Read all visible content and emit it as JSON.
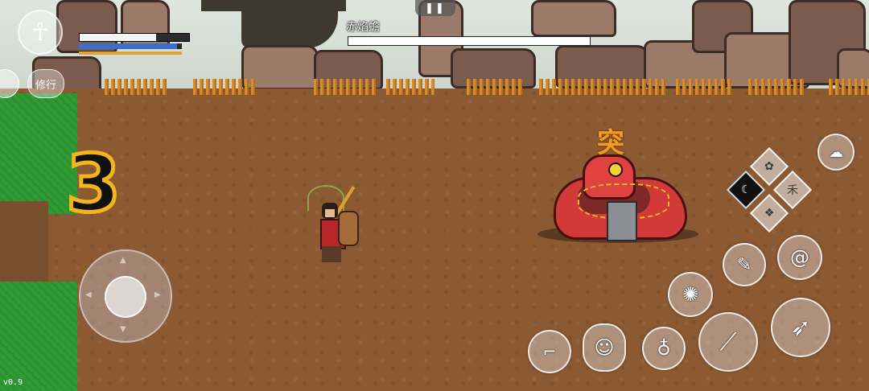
{
  "hud": {
    "avatar_icon": "monkey-king-silhouette-icon",
    "hp_fill": 0.7,
    "mp_fill": 0.95,
    "stamina_fill": 1.0,
    "cultivate_label": "修行"
  },
  "boss": {
    "name": "赤焰蟾",
    "hp_fill": 1.0,
    "mark": "突"
  },
  "pause": {
    "label": "❚❚"
  },
  "wave": {
    "number": "3"
  },
  "version": "v0.9",
  "skills": {
    "top_right": "spirit-cloud-icon",
    "transform_label": "禾",
    "gun_icon": "rifle-icon",
    "gourd_icon": "gourd-icon",
    "staff_icon": "staff-icon",
    "horn_icon": "horn-icon",
    "spiral_icon": "spiral-icon",
    "swirl_icon": "swirl-icon",
    "scroll_icon": "scroll-icon",
    "portrait_icon": "portrait-icon"
  },
  "colors": {
    "ground": "#8b5a33",
    "grass": "#2f9a34",
    "wave_stroke": "#f2b51b",
    "boss_body": "#d23a3a"
  }
}
